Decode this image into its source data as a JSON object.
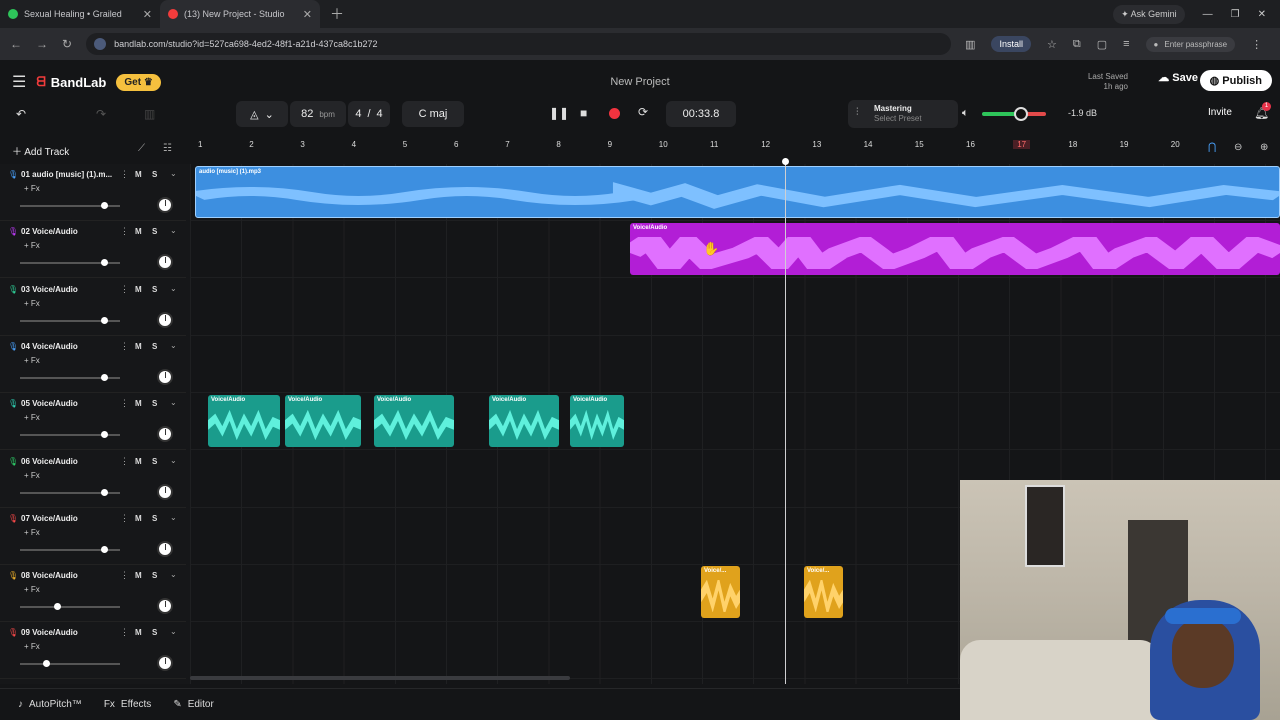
{
  "browser": {
    "tabs": [
      {
        "title": "Sexual Healing • Grailed",
        "active": false
      },
      {
        "title": "(13) New Project - Studio",
        "active": true
      }
    ],
    "url": "bandlab.com/studio?id=527ca698-4ed2-48f1-a21d-437ca8c1b272",
    "install_label": "Install",
    "passphrase_label": "Enter passphrase",
    "gemini_label": "Ask Gemini"
  },
  "app": {
    "brand": "BandLab",
    "get_label": "Get",
    "project_title": "New Project",
    "last_saved_label": "Last Saved",
    "last_saved_time": "1h ago",
    "save_label": "Save",
    "publish_label": "Publish"
  },
  "transport": {
    "bpm": "82",
    "bpm_unit": "bpm",
    "time_sig_num": "4",
    "time_sig_den": "4",
    "key": "C maj",
    "time": "00:33.8",
    "mastering_label": "Mastering",
    "mastering_preset": "Select Preset",
    "volume_db": "-1.9 dB",
    "invite_label": "Invite",
    "notifications": "1"
  },
  "ruler": {
    "bars": [
      "1",
      "2",
      "3",
      "4",
      "5",
      "6",
      "7",
      "8",
      "9",
      "10",
      "11",
      "12",
      "13",
      "14",
      "15",
      "16",
      "17",
      "18",
      "19",
      "20"
    ],
    "highlighted": "17"
  },
  "tracks_header": {
    "add_track_label": "Add Track"
  },
  "tracks": [
    {
      "number": "01",
      "name": "audio [music] (1).m...",
      "fx": "+ Fx",
      "color": "#4aa3ff",
      "fader": 0.84
    },
    {
      "number": "02",
      "name": "Voice/Audio",
      "fx": "+ Fx",
      "color": "#c23cff",
      "fader": 0.84
    },
    {
      "number": "03",
      "name": "Voice/Audio",
      "fx": "+ Fx",
      "color": "#2fd39a",
      "fader": 0.84
    },
    {
      "number": "04",
      "name": "Voice/Audio",
      "fx": "+ Fx",
      "color": "#4aa3ff",
      "fader": 0.84
    },
    {
      "number": "05",
      "name": "Voice/Audio",
      "fx": "+ Fx",
      "color": "#2fd3b5",
      "fader": 0.84
    },
    {
      "number": "06",
      "name": "Voice/Audio",
      "fx": "+ Fx",
      "color": "#2fd36a",
      "fader": 0.84
    },
    {
      "number": "07",
      "name": "Voice/Audio",
      "fx": "+ Fx",
      "color": "#ff4a4a",
      "fader": 0.84
    },
    {
      "number": "08",
      "name": "Voice/Audio",
      "fx": "+ Fx",
      "color": "#f2b32a",
      "fader": 0.37
    },
    {
      "number": "09",
      "name": "Voice/Audio",
      "fx": "+ Fx",
      "color": "#ff4a4a",
      "fader": 0.26
    }
  ],
  "track_buttons": {
    "mute": "M",
    "solo": "S"
  },
  "clips": {
    "track1": {
      "label": "audio [music] (1).mp3"
    },
    "track2": {
      "label": "Voice/Audio"
    },
    "track5": [
      "Voice/Audio",
      "Voice/Audio",
      "Voice/Audio",
      "Voice/Audio",
      "Voice/Audio"
    ],
    "track8": [
      "Voice/...",
      "Voice/..."
    ]
  },
  "bottom": {
    "autopitch_label": "AutoPitch™",
    "effects_label": "Effects",
    "editor_label": "Editor"
  },
  "colors": {
    "blue_clip": "#3d8fe0",
    "purple_clip": "#b21ed6",
    "teal_clip": "#1a9c8c",
    "gold_clip": "#e0a21c"
  }
}
